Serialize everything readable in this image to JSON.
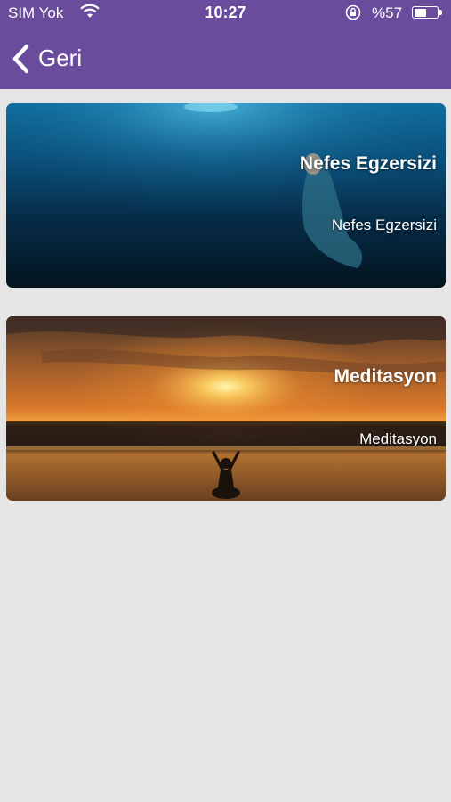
{
  "status": {
    "carrier": "SIM Yok",
    "time": "10:27",
    "battery_percent_text": "%57",
    "battery_level": 0.57
  },
  "nav": {
    "back_label": "Geri"
  },
  "cards": [
    {
      "title": "Nefes Egzersizi",
      "subtitle": "Nefes Egzersizi"
    },
    {
      "title": "Meditasyon",
      "subtitle": "Meditasyon"
    }
  ],
  "colors": {
    "header": "#6a4c9c",
    "background": "#e5e5e5"
  }
}
